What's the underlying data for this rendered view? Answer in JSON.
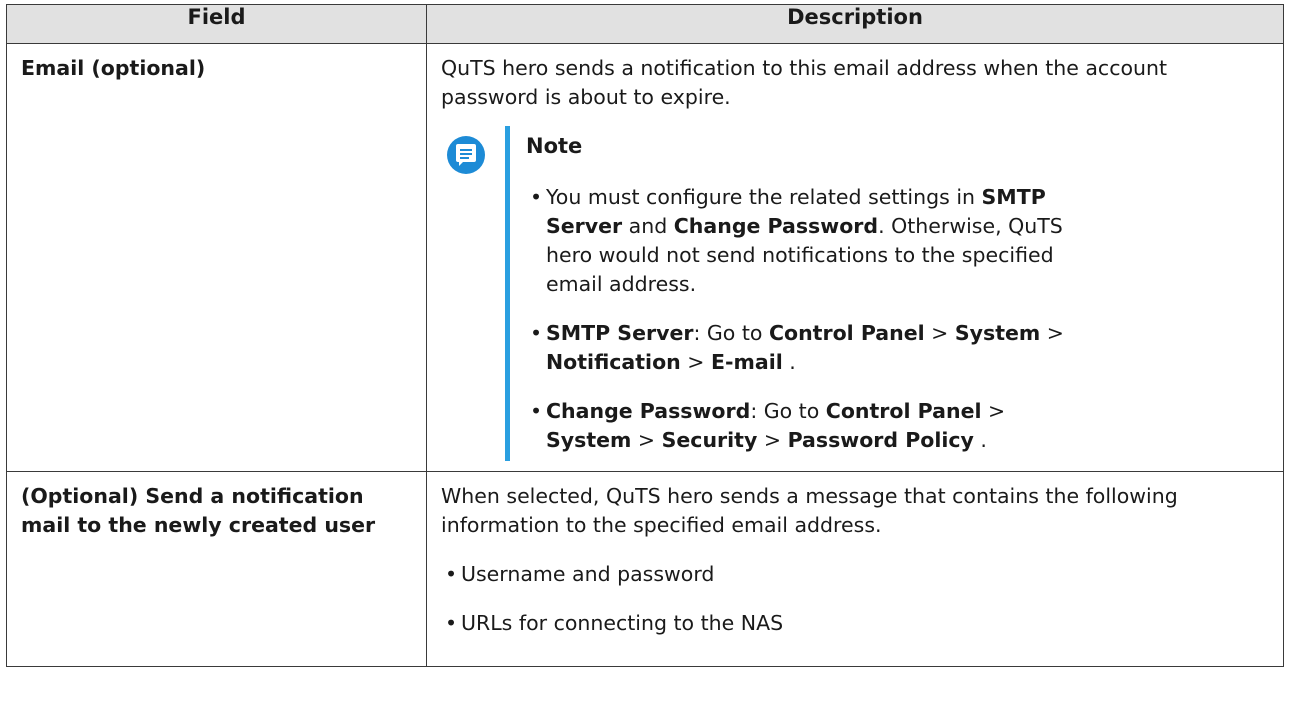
{
  "table": {
    "headers": {
      "field": "Field",
      "description": "Description"
    },
    "rows": [
      {
        "field": "Email (optional)",
        "description": "QuTS hero sends a notification to this email address when the account password is about to expire.",
        "note": {
          "title": "Note",
          "items": [
            {
              "p1": "You must configure the related settings in ",
              "b1": "SMTP Server",
              "p2": " and ",
              "b2": "Change Password",
              "p3": ". Otherwise, QuTS hero would not send notifications to the specified email address."
            },
            {
              "b1": "SMTP Server",
              "p1": ": Go to ",
              "b2": "Control Panel",
              "p2": " > ",
              "b3": "System",
              "p3": " > ",
              "b4": "Notification",
              "p4": " > ",
              "b5": "E-mail",
              "p5": " ."
            },
            {
              "b1": "Change Password",
              "p1": ": Go to ",
              "b2": "Control Panel",
              "p2": " > ",
              "b3": "System",
              "p3": " > ",
              "b4": "Security",
              "p4": " > ",
              "b5": "Password Policy",
              "p5": " ."
            }
          ]
        }
      },
      {
        "field": "(Optional) Send a notification mail to the newly created user",
        "description": "When selected, QuTS hero sends a message that contains the following information to the specified email address.",
        "items": [
          "Username and password",
          "URLs for connecting to the NAS"
        ]
      }
    ]
  },
  "icons": {
    "note_icon": "note-icon"
  },
  "colors": {
    "header_bg": "#e1e1e1",
    "note_accent": "#2a9fe0",
    "note_icon": "#1d8bd6"
  }
}
